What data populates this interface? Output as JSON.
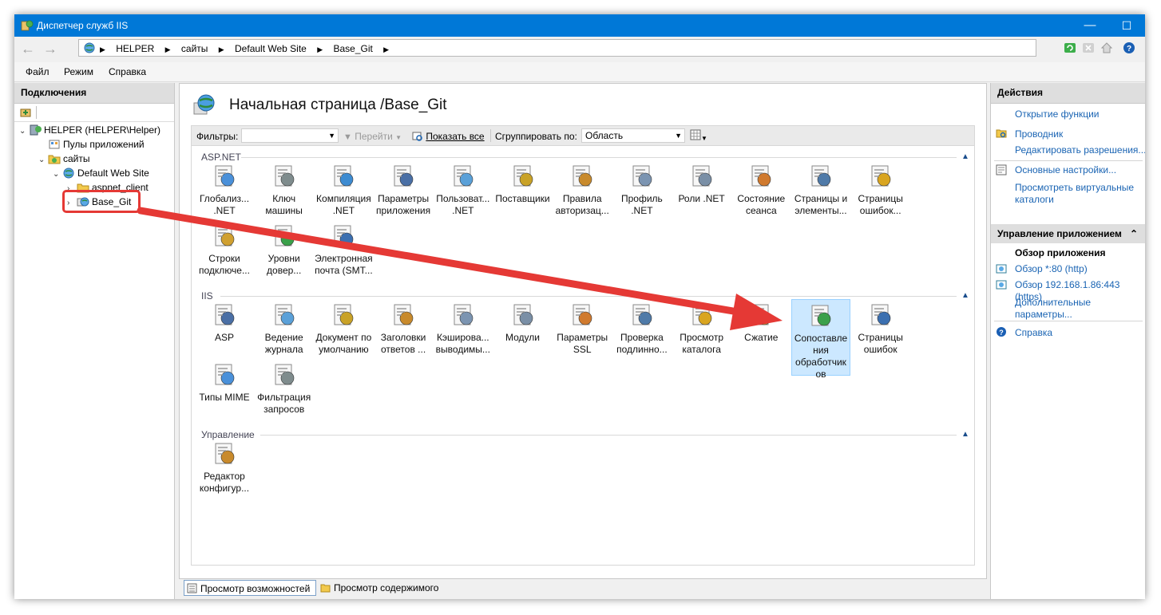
{
  "window": {
    "title": "Диспетчер служб IIS",
    "minimize": "—",
    "maximize": "☐",
    "close": "✕",
    "title_color": "#0078d7"
  },
  "address": {
    "crumbs": [
      "HELPER",
      "сайты",
      "Default Web Site",
      "Base_Git"
    ],
    "separator": "▶"
  },
  "menu": [
    "Файл",
    "Режим",
    "Справка"
  ],
  "connections": {
    "header": "Подключения",
    "tree": [
      {
        "label": "HELPER (HELPER\\Helper)",
        "twisty": "⌄",
        "icon": "server-icon"
      },
      {
        "label": "Пулы приложений",
        "twisty": "",
        "icon": "app-pools-icon"
      },
      {
        "label": "сайты",
        "twisty": "⌄",
        "icon": "sites-folder-icon"
      },
      {
        "label": "Default Web Site",
        "twisty": "⌄",
        "icon": "globe-icon"
      },
      {
        "label": "aspnet_client",
        "twisty": "›",
        "icon": "folder-icon"
      },
      {
        "label": "Base_Git",
        "twisty": "›",
        "icon": "web-app-icon"
      }
    ]
  },
  "main": {
    "title": "Начальная страница /Base_Git",
    "filter": {
      "label": "Фильтры:",
      "go": "Перейти",
      "show_all": "Показать все",
      "group_by_label": "Сгруппировать по:",
      "group_by_value": "Область"
    },
    "groups": [
      {
        "name": "ASP.NET",
        "items": [
          {
            "label": "Глобализ... .NET",
            "icon": "globalization-icon"
          },
          {
            "label": "Ключ машины",
            "icon": "machine-key-icon"
          },
          {
            "label": "Компиляция .NET",
            "icon": "compilation-icon"
          },
          {
            "label": "Параметры приложения",
            "icon": "app-settings-icon"
          },
          {
            "label": "Пользоват... .NET",
            "icon": "net-users-icon"
          },
          {
            "label": "Поставщики",
            "icon": "providers-icon"
          },
          {
            "label": "Правила авторизац...",
            "icon": "authorization-rules-icon"
          },
          {
            "label": "Профиль .NET",
            "icon": "net-profile-icon"
          },
          {
            "label": "Роли .NET",
            "icon": "net-roles-icon"
          },
          {
            "label": "Состояние сеанса",
            "icon": "session-state-icon"
          },
          {
            "label": "Страницы и элементы...",
            "icon": "pages-controls-icon"
          },
          {
            "label": "Страницы ошибок...",
            "icon": "error-pages-icon"
          },
          {
            "label": "Строки подключе...",
            "icon": "connection-strings-icon"
          },
          {
            "label": "Уровни довер...",
            "icon": "trust-levels-icon"
          },
          {
            "label": "Электронная почта (SMT...",
            "icon": "smtp-email-icon"
          }
        ]
      },
      {
        "name": "IIS",
        "items": [
          {
            "label": "ASP",
            "icon": "asp-icon"
          },
          {
            "label": "Ведение журнала",
            "icon": "logging-icon"
          },
          {
            "label": "Документ по умолчанию",
            "icon": "default-document-icon"
          },
          {
            "label": "Заголовки ответов ...",
            "icon": "response-headers-icon"
          },
          {
            "label": "Кэширова... выводимы...",
            "icon": "output-caching-icon"
          },
          {
            "label": "Модули",
            "icon": "modules-icon"
          },
          {
            "label": "Параметры SSL",
            "icon": "ssl-settings-icon"
          },
          {
            "label": "Проверка подлинно...",
            "icon": "authentication-icon"
          },
          {
            "label": "Просмотр каталога",
            "icon": "directory-browsing-icon"
          },
          {
            "label": "Сжатие",
            "icon": "compression-icon"
          },
          {
            "label": "Сопоставле ния обработчик ов",
            "icon": "handler-mappings-icon"
          },
          {
            "label": "Страницы ошибок",
            "icon": "error-pages-icon"
          },
          {
            "label": "Типы MIME",
            "icon": "mime-types-icon"
          },
          {
            "label": "Фильтрация запросов",
            "icon": "request-filtering-icon"
          }
        ]
      },
      {
        "name": "Управление",
        "items": [
          {
            "label": "Редактор конфигур...",
            "icon": "config-editor-icon"
          }
        ]
      }
    ],
    "selected_item": "Сопоставле ния обработчик ов",
    "collapse_glyph": "▲"
  },
  "view_tabs": [
    {
      "label": "Просмотр возможностей",
      "active": true
    },
    {
      "label": "Просмотр содержимого",
      "active": false
    }
  ],
  "actions": {
    "header": "Действия",
    "open_feature": "Открытие функции",
    "explorer": "Проводник",
    "edit_permissions": "Редактировать разрешения...",
    "basic_settings": "Основные настройки...",
    "view_virtual_dirs": "Просмотреть виртуальные каталоги",
    "manage_header": "Управление приложением",
    "manage_collapse": "⌃",
    "browse_app_header": "Обзор приложения",
    "browse_http": "Обзор *:80 (http)",
    "browse_https": "Обзор 192.168.1.86:443 (https)",
    "advanced": "Дополнительные параметры...",
    "help": "Справка"
  },
  "colors": {
    "link": "#1a64b3",
    "selection": "#cce8ff",
    "annotation_red": "#e53935"
  }
}
